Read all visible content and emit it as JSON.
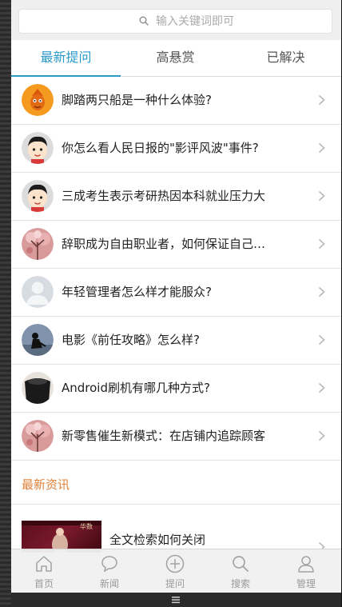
{
  "search": {
    "placeholder": "输入关键词即可",
    "icon": "search-icon"
  },
  "tabs": [
    {
      "label": "最新提问",
      "active": true
    },
    {
      "label": "高悬赏",
      "active": false
    },
    {
      "label": "已解决",
      "active": false
    }
  ],
  "questions": [
    {
      "title": "脚踏两只船是一种什么体验?",
      "avatar": "orange-cartoon-avatar"
    },
    {
      "title": "你怎么看人民日报的\"影评风波\"事件?",
      "avatar": "cartoon-boy-avatar"
    },
    {
      "title": "三成考生表示考研热因本科就业压力大",
      "avatar": "cartoon-boy-avatar"
    },
    {
      "title": "辞职成为自由职业者，如何保证自己的收入?",
      "avatar": "pink-tree-avatar"
    },
    {
      "title": "年轻管理者怎么样才能服众?",
      "avatar": "default-user-avatar"
    },
    {
      "title": "电影《前任攻略》怎么样?",
      "avatar": "silhouette-avatar"
    },
    {
      "title": "Android刷机有哪几种方式?",
      "avatar": "dark-photo-avatar"
    },
    {
      "title": "新零售催生新模式：在店铺内追踪顾客",
      "avatar": "pink-tree-avatar"
    }
  ],
  "news": {
    "section_title": "最新资讯",
    "items": [
      {
        "title": "全文检索如何关闭",
        "thumb_text": "华数"
      }
    ]
  },
  "bottom_nav": [
    {
      "label": "首页",
      "icon": "home-icon"
    },
    {
      "label": "新闻",
      "icon": "chat-bubble-icon"
    },
    {
      "label": "提问",
      "icon": "plus-circle-icon"
    },
    {
      "label": "搜索",
      "icon": "search-icon"
    },
    {
      "label": "管理",
      "icon": "user-icon"
    }
  ],
  "colors": {
    "accent": "#2a9bc9",
    "news_accent": "#e0813a",
    "text": "#222222",
    "muted": "#9a9a9a"
  }
}
